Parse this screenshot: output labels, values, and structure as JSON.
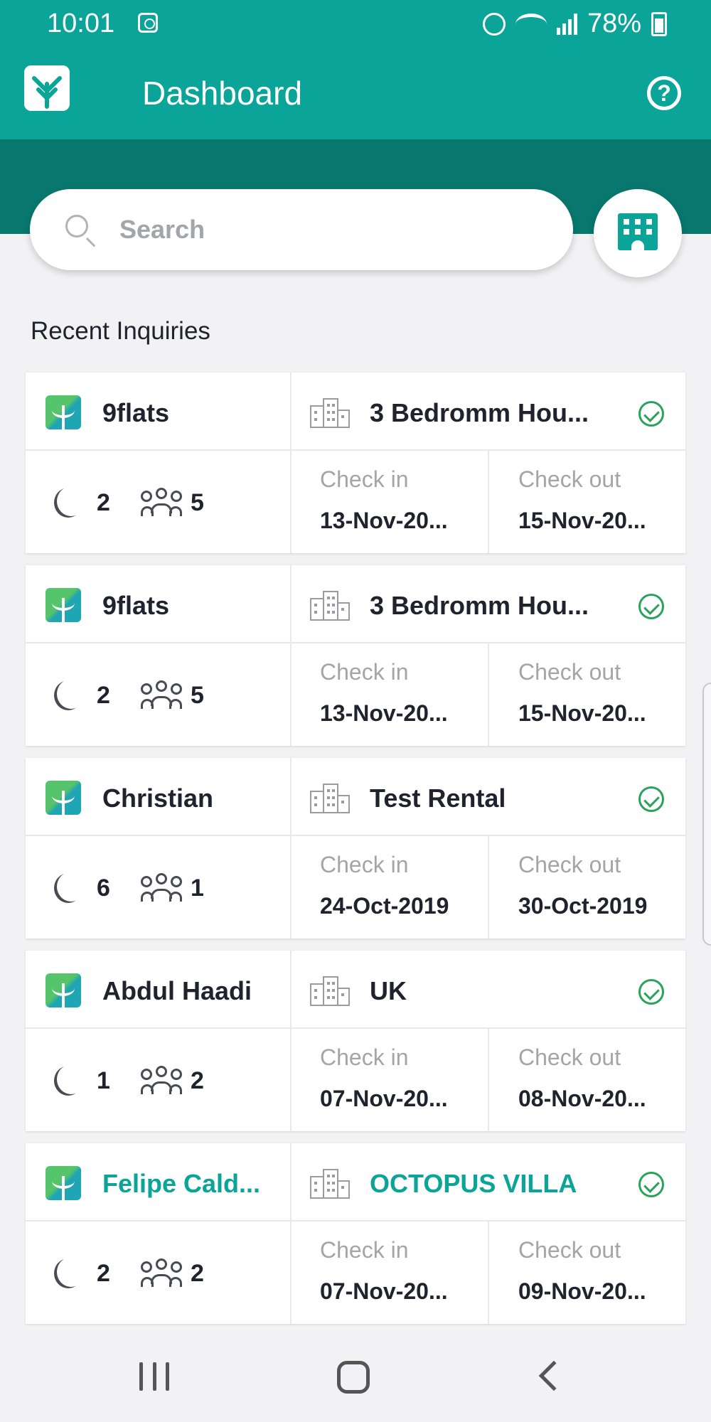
{
  "status_bar": {
    "time": "10:01",
    "battery": "78%"
  },
  "app_bar": {
    "title": "Dashboard"
  },
  "search": {
    "placeholder": "Search"
  },
  "section": {
    "title": "Recent Inquiries"
  },
  "colors": {
    "primary": "#0aa498",
    "primary_dark": "#08786f",
    "status_ok": "#2aa35a",
    "background": "#f2f2f5"
  },
  "labels": {
    "check_in": "Check in",
    "check_out": "Check out"
  },
  "inquiries": [
    {
      "guest": "9flats",
      "property": "3 Bedromm Hou...",
      "nights": "2",
      "guests": "5",
      "check_in": "13-Nov-20...",
      "check_out": "15-Nov-20...",
      "highlighted": false
    },
    {
      "guest": "9flats",
      "property": "3 Bedromm Hou...",
      "nights": "2",
      "guests": "5",
      "check_in": "13-Nov-20...",
      "check_out": "15-Nov-20...",
      "highlighted": false
    },
    {
      "guest": "Christian",
      "property": "Test Rental",
      "nights": "6",
      "guests": "1",
      "check_in": "24-Oct-2019",
      "check_out": "30-Oct-2019",
      "highlighted": false
    },
    {
      "guest": "Abdul Haadi",
      "property": "UK",
      "nights": "1",
      "guests": "2",
      "check_in": "07-Nov-20...",
      "check_out": "08-Nov-20...",
      "highlighted": false
    },
    {
      "guest": "Felipe Cald...",
      "property": "OCTOPUS VILLA",
      "nights": "2",
      "guests": "2",
      "check_in": "07-Nov-20...",
      "check_out": "09-Nov-20...",
      "highlighted": true
    }
  ]
}
